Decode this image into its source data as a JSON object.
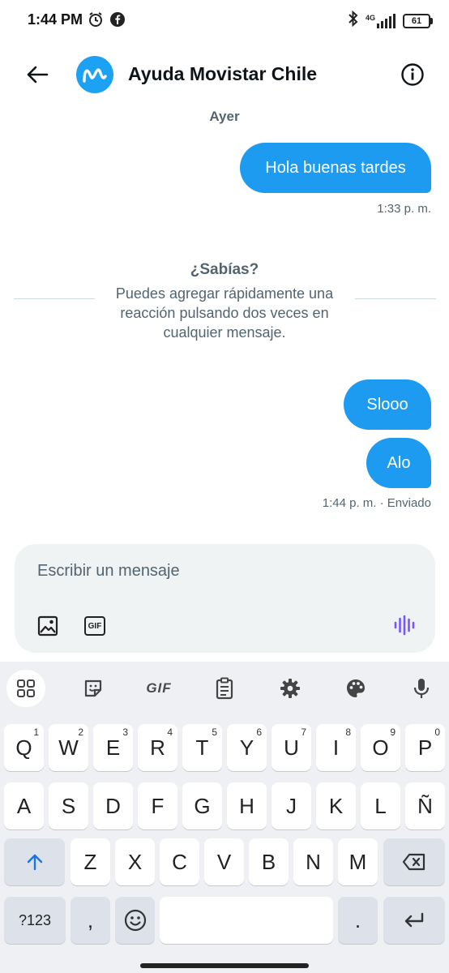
{
  "status_bar": {
    "time": "1:44 PM",
    "network_label": "4G",
    "battery": "61",
    "icons": [
      "alarm-icon",
      "facebook-icon",
      "bluetooth-icon",
      "signal-icon",
      "battery-icon"
    ]
  },
  "header": {
    "title": "Ayuda Movistar Chile",
    "avatar_letter": "M",
    "icons": [
      "back-arrow-icon",
      "info-icon"
    ]
  },
  "chat": {
    "day_label": "Ayer",
    "messages": [
      {
        "text": "Hola buenas tardes",
        "meta": "1:33 p. m."
      },
      {
        "text": "Slooo"
      },
      {
        "text": "Alo",
        "meta": "1:44 p. m. · Enviado"
      }
    ],
    "tip": {
      "title": "¿Sabías?",
      "text": "Puedes agregar rápidamente una reacción pulsando dos veces en cualquier mensaje."
    }
  },
  "composer": {
    "placeholder": "Escribir un mensaje",
    "gif_label": "GIF",
    "accent_color": "#7856ff"
  },
  "keyboard": {
    "toolbar_gif": "GIF",
    "row1": [
      {
        "k": "Q",
        "h": "1"
      },
      {
        "k": "W",
        "h": "2"
      },
      {
        "k": "E",
        "h": "3"
      },
      {
        "k": "R",
        "h": "4"
      },
      {
        "k": "T",
        "h": "5"
      },
      {
        "k": "Y",
        "h": "6"
      },
      {
        "k": "U",
        "h": "7"
      },
      {
        "k": "I",
        "h": "8"
      },
      {
        "k": "O",
        "h": "9"
      },
      {
        "k": "P",
        "h": "0"
      }
    ],
    "row2": [
      "A",
      "S",
      "D",
      "F",
      "G",
      "H",
      "J",
      "K",
      "L",
      "Ñ"
    ],
    "row3": [
      "Z",
      "X",
      "C",
      "V",
      "B",
      "N",
      "M"
    ],
    "symbols_label": "?123",
    "comma": ",",
    "period": "."
  },
  "colors": {
    "bubble": "#1d9bf0",
    "muted_text": "#536471",
    "composer_bg": "#eff3f4",
    "keyboard_bg": "#eef0f4"
  }
}
